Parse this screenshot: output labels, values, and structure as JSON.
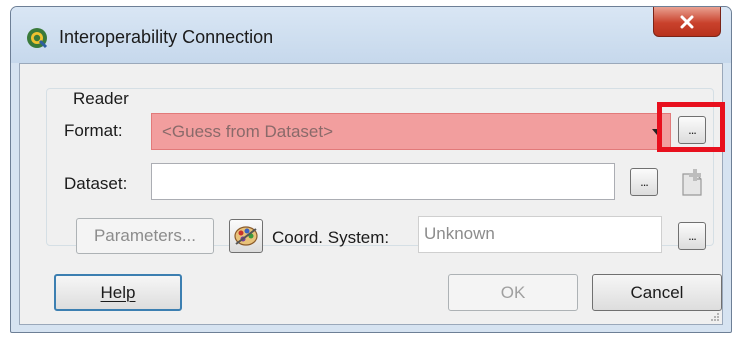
{
  "window": {
    "title": "Interoperability Connection",
    "close_symbol": "X",
    "icon": "qgis-icon"
  },
  "reader": {
    "group_label": "Reader",
    "format_label": "Format:",
    "format_value": "<Guess from Dataset>",
    "format_browse_label": "...",
    "dataset_label": "Dataset:",
    "dataset_value": "",
    "dataset_browse_label": "...",
    "parameters_label": "Parameters...",
    "coord_label": "Coord. System:",
    "coord_value": "Unknown",
    "coord_browse_label": "..."
  },
  "footer": {
    "help_label": "Help",
    "ok_label": "OK",
    "cancel_label": "Cancel"
  },
  "colors": {
    "format_invalid_bg": "#f29e9e",
    "highlight": "#e8101e",
    "close_button": "#c9412c"
  }
}
